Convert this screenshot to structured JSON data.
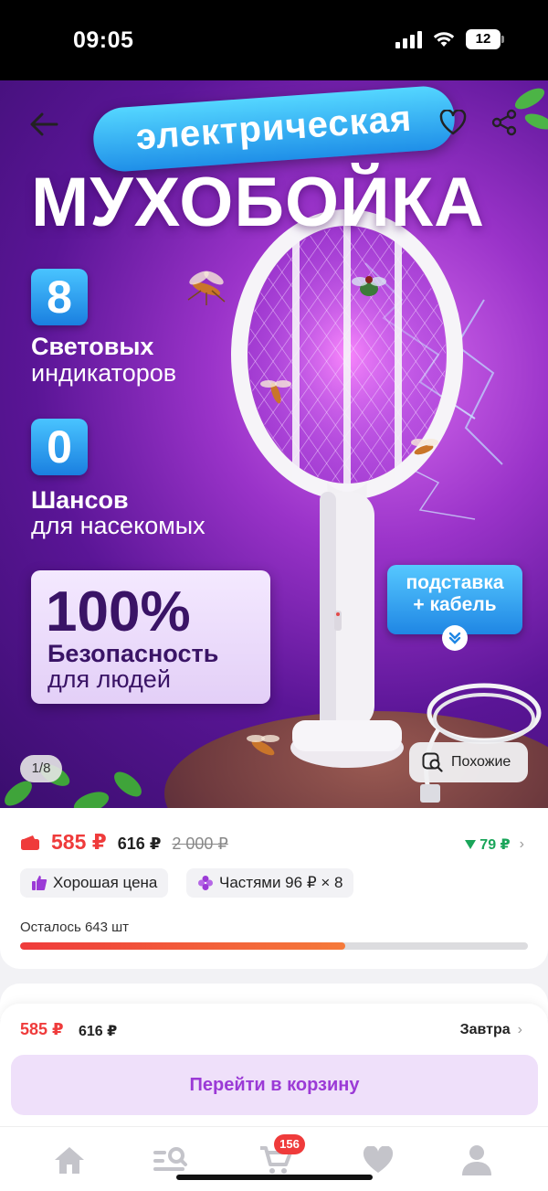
{
  "status_bar": {
    "time": "09:05",
    "battery": "12"
  },
  "hero": {
    "pill_title": "электрическая",
    "big_title": "МУХОБОЙКА",
    "feature1": {
      "number": "8",
      "bold": "Световых",
      "light": "индикаторов"
    },
    "feature2": {
      "number": "0",
      "bold": "Шансов",
      "light": "для насекомых"
    },
    "safety": {
      "percent": "100%",
      "bold": "Безопасность",
      "light": "для людей"
    },
    "stand_badge": {
      "line1": "подставка",
      "line2": "+ кабель"
    },
    "image_counter": "1/8",
    "similar_label": "Похожие",
    "icons": {
      "back": "arrow-left-icon",
      "favorite": "heart-icon",
      "share": "share-icon"
    }
  },
  "price": {
    "current": "585 ₽",
    "card_price": "616 ₽",
    "old_price": "2 000 ₽",
    "cashback": "79 ₽",
    "chips": [
      {
        "label": "Хорошая цена",
        "icon": "thumbs-up-icon"
      },
      {
        "label": "Частями 96 ₽ × 8",
        "icon": "installments-icon"
      }
    ],
    "stock_label": "Осталось 643 шт",
    "stock_progress": 0.64
  },
  "bottom_sheet": {
    "price": "585 ₽",
    "card_price": "616 ₽",
    "delivery": "Завтра",
    "cart_button": "Перейти в корзину"
  },
  "tabbar": {
    "cart_count": "156",
    "items": [
      "home-icon",
      "catalog-search-icon",
      "cart-icon",
      "favorites-icon",
      "profile-icon"
    ]
  },
  "colors": {
    "accent_red": "#ef3b3b",
    "accent_purple": "#9b3ad6",
    "cashback_green": "#1aa55a",
    "badge_blue": "#1f86e4"
  }
}
